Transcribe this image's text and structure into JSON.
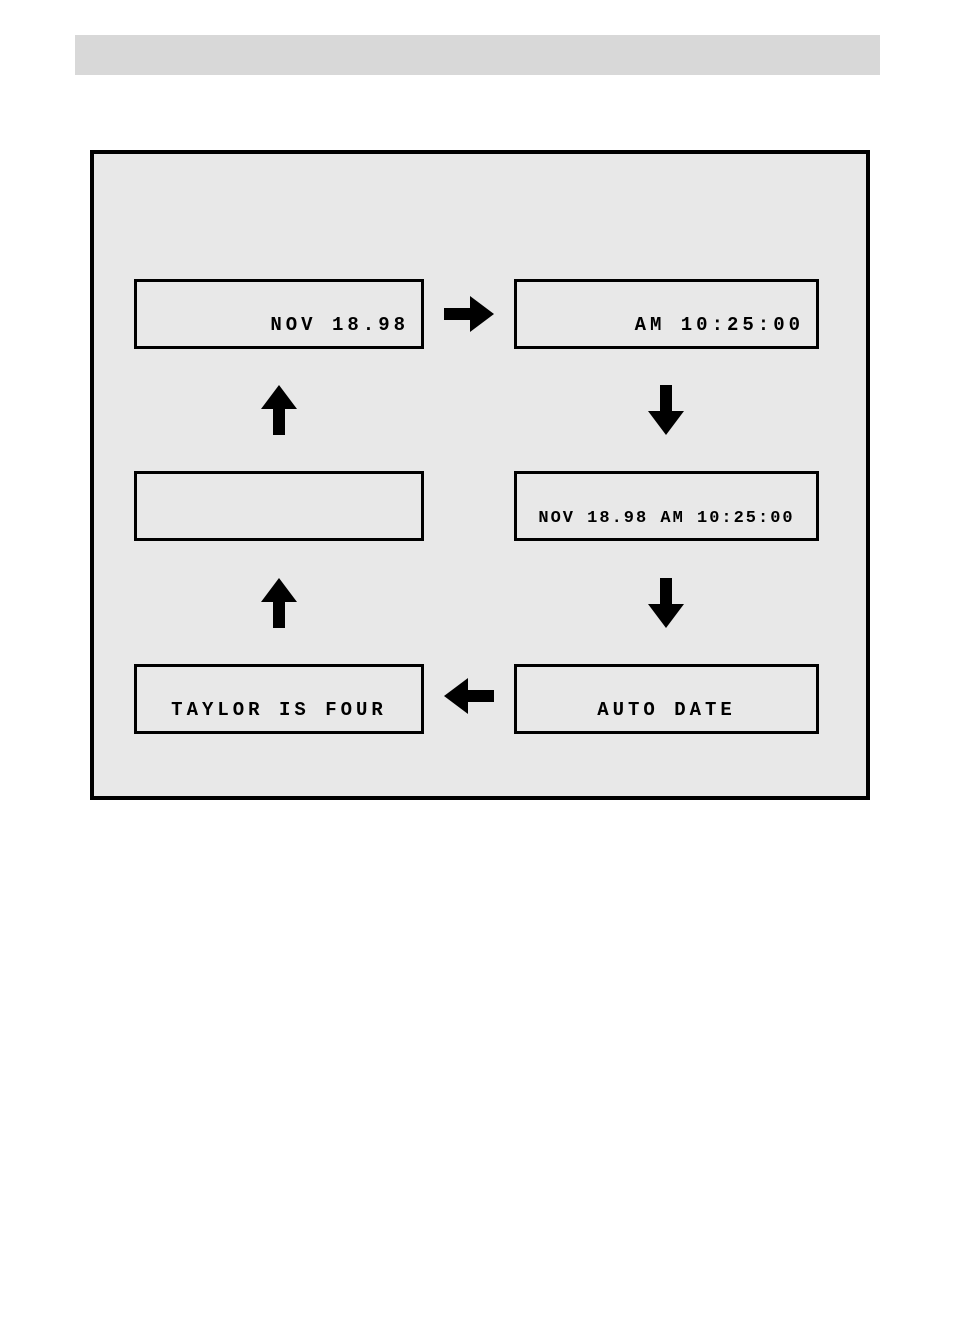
{
  "diagram": {
    "top_left_text": "NOV 18.98",
    "top_right_text": "AM 10:25:00",
    "mid_left_text": "",
    "mid_right_text": "NOV 18.98 AM 10:25:00",
    "bot_left_text": "TAYLOR IS FOUR",
    "bot_right_text": "AUTO DATE"
  }
}
